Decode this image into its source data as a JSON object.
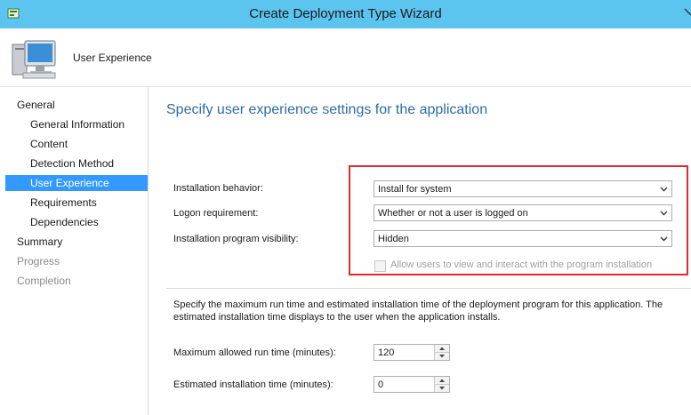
{
  "window": {
    "title": "Create Deployment Type Wizard"
  },
  "header": {
    "page_label": "User Experience"
  },
  "sidebar": {
    "items": [
      {
        "label": "General"
      },
      {
        "label": "General Information"
      },
      {
        "label": "Content"
      },
      {
        "label": "Detection Method"
      },
      {
        "label": "User Experience"
      },
      {
        "label": "Requirements"
      },
      {
        "label": "Dependencies"
      },
      {
        "label": "Summary"
      },
      {
        "label": "Progress"
      },
      {
        "label": "Completion"
      }
    ]
  },
  "main": {
    "heading": "Specify user experience settings for the application",
    "installation_behavior": {
      "label": "Installation behavior:",
      "value": "Install for system"
    },
    "logon_requirement": {
      "label": "Logon requirement:",
      "value": "Whether or not a user is logged on"
    },
    "program_visibility": {
      "label": "Installation program visibility:",
      "value": "Hidden"
    },
    "allow_interact": {
      "label": "Allow users to view and interact with the program installation",
      "checked": false
    },
    "description": "Specify the maximum run time and estimated installation time of the deployment program for this application. The estimated installation time displays to the user when the application installs.",
    "max_run_time": {
      "label": "Maximum allowed run time (minutes):",
      "value": "120"
    },
    "estimated_time": {
      "label": "Estimated installation time (minutes):",
      "value": "0"
    }
  },
  "colors": {
    "titlebar": "#5bc5f0",
    "selected": "#3399ff",
    "heading": "#2e6da4",
    "highlight": "#e0282e"
  }
}
